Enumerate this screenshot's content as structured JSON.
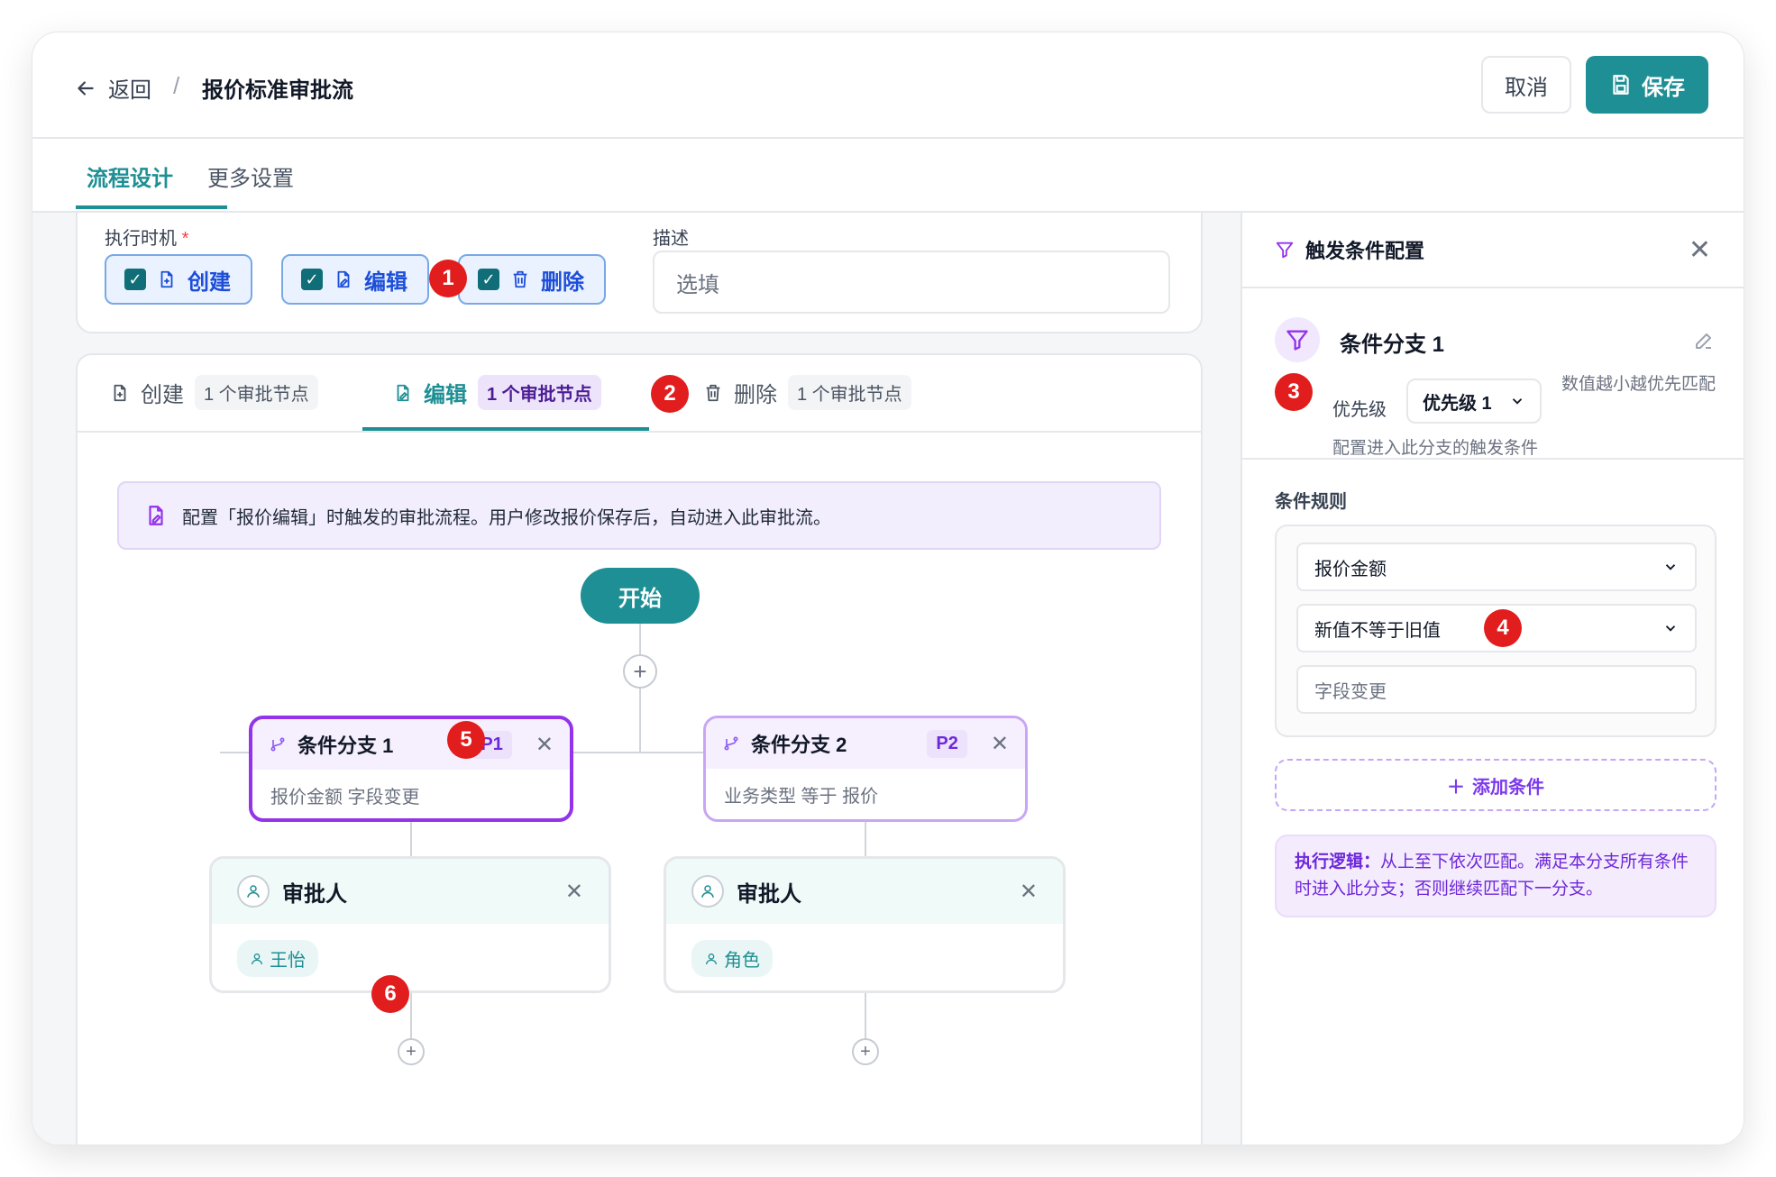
{
  "header": {
    "back_label": "返回",
    "separator": "/",
    "title": "报价标准审批流",
    "cancel_label": "取消",
    "save_label": "保存"
  },
  "tabs": [
    {
      "label": "流程设计"
    },
    {
      "label": "更多设置"
    }
  ],
  "exec": {
    "label": "执行时机",
    "required_mark": "*",
    "options": [
      {
        "label": "创建",
        "checked": true
      },
      {
        "label": "编辑",
        "checked": true
      },
      {
        "label": "删除",
        "checked": true
      }
    ],
    "desc_label": "描述",
    "desc_placeholder": "选填"
  },
  "flow_tabs": [
    {
      "label": "创建",
      "count": "1 个审批节点"
    },
    {
      "label": "编辑",
      "count": "1 个审批节点"
    },
    {
      "label": "删除",
      "count": "1 个审批节点"
    }
  ],
  "info_text": "配置「报价编辑」时触发的审批流程。用户修改报价保存后，自动进入此审批流。",
  "start_label": "开始",
  "branches": [
    {
      "title": "条件分支 1",
      "priority": "P1",
      "summary": "报价金额 字段变更"
    },
    {
      "title": "条件分支 2",
      "priority": "P2",
      "summary": "业务类型 等于 报价"
    }
  ],
  "approvers": [
    {
      "title": "审批人",
      "tag": "王怡"
    },
    {
      "title": "审批人",
      "tag": "角色"
    }
  ],
  "markers": [
    "1",
    "2",
    "3",
    "4",
    "5",
    "6"
  ],
  "panel": {
    "title": "触发条件配置",
    "branch_name": "条件分支 1",
    "priority_label": "优先级",
    "priority_value": "优先级 1",
    "priority_hint": "数值越小越优先匹配",
    "sub_hint": "配置进入此分支的触发条件",
    "rules_title": "条件规则",
    "field_value": "报价金额",
    "operator_value": "新值不等于旧值",
    "value_placeholder": "字段变更",
    "add_condition": "添加条件",
    "logic_label": "执行逻辑：",
    "logic_text": "从上至下依次匹配。满足本分支所有条件时进入此分支；否则继续匹配下一分支。"
  },
  "colors": {
    "accent": "#1e8f94",
    "purple": "#9333ea",
    "marker": "#e11d1d"
  }
}
